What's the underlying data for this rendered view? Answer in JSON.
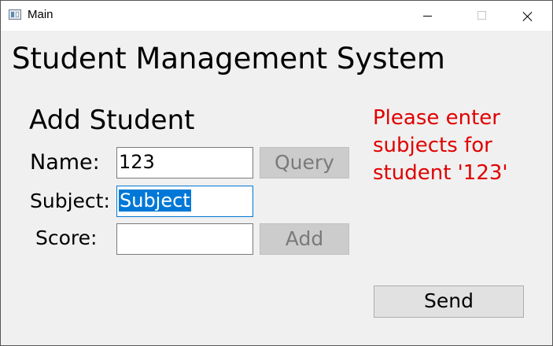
{
  "window": {
    "title": "Main"
  },
  "app": {
    "title": "Student Management System"
  },
  "form": {
    "section_title": "Add Student",
    "name_label": "Name:",
    "name_value": "123",
    "subject_label": "Subject:",
    "subject_value": "Subject",
    "score_label": "Score:",
    "score_value": "",
    "query_label": "Query",
    "add_label": "Add"
  },
  "message": {
    "text": "Please enter subjects for student '123'",
    "color": "#e00000"
  },
  "footer": {
    "send_label": "Send"
  },
  "colors": {
    "selection": "#0078d7",
    "window_bg": "#f0f0f0",
    "disabled_button": "#cccccc"
  },
  "icons": {
    "app": "window-app-icon",
    "minimize": "minimize-icon",
    "maximize": "maximize-icon",
    "close": "close-icon"
  }
}
